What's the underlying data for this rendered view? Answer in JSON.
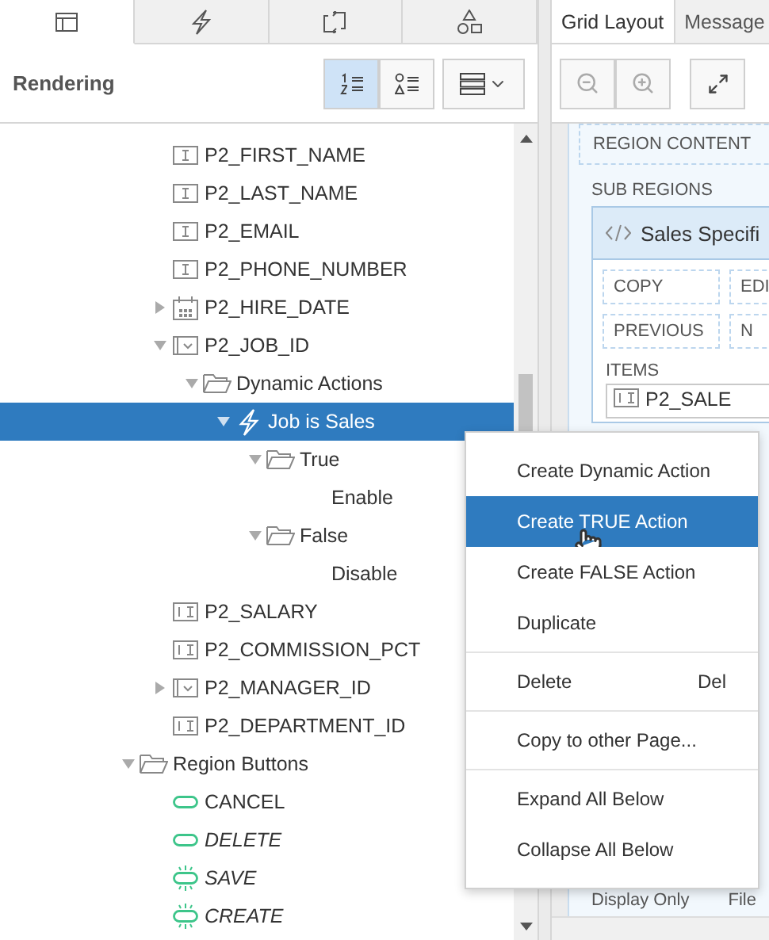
{
  "left_tabs": [
    {
      "kind": "layout",
      "selected": true
    },
    {
      "kind": "lightning",
      "selected": false
    },
    {
      "kind": "loop",
      "selected": false
    },
    {
      "kind": "shapes",
      "selected": false
    }
  ],
  "toolbar": {
    "title": "Rendering",
    "view_buttons": [
      {
        "kind": "numbered",
        "selected": true
      },
      {
        "kind": "shapes",
        "selected": false
      }
    ]
  },
  "tree": {
    "items": [
      {
        "label": "P2_FIRST_NAME",
        "kind": "text"
      },
      {
        "label": "P2_LAST_NAME",
        "kind": "text"
      },
      {
        "label": "P2_EMAIL",
        "kind": "text"
      },
      {
        "label": "P2_PHONE_NUMBER",
        "kind": "text"
      },
      {
        "label": "P2_HIRE_DATE",
        "kind": "date",
        "expanded": false
      },
      {
        "label": "P2_JOB_ID",
        "kind": "select",
        "expanded": true,
        "children": [
          {
            "label": "Dynamic Actions",
            "kind": "folder",
            "expanded": true,
            "children": [
              {
                "label": "Job is Sales",
                "kind": "action",
                "expanded": true,
                "selected": true,
                "children": [
                  {
                    "label": "True",
                    "kind": "folder",
                    "expanded": true,
                    "children": [
                      {
                        "label": "Enable"
                      }
                    ]
                  },
                  {
                    "label": "False",
                    "kind": "folder",
                    "expanded": true,
                    "children": [
                      {
                        "label": "Disable"
                      }
                    ]
                  }
                ]
              }
            ]
          }
        ]
      },
      {
        "label": "P2_SALARY",
        "kind": "number"
      },
      {
        "label": "P2_COMMISSION_PCT",
        "kind": "number"
      },
      {
        "label": "P2_MANAGER_ID",
        "kind": "select",
        "expanded": false
      },
      {
        "label": "P2_DEPARTMENT_ID",
        "kind": "number"
      }
    ],
    "region_buttons": {
      "label": "Region Buttons",
      "kind": "folder",
      "expanded": true,
      "children": [
        {
          "label": "CANCEL",
          "kind": "button",
          "conditional": false
        },
        {
          "label": "DELETE",
          "kind": "button",
          "conditional": true
        },
        {
          "label": "SAVE",
          "kind": "hot",
          "conditional": true
        },
        {
          "label": "CREATE",
          "kind": "hot",
          "conditional": true
        }
      ]
    }
  },
  "right_tabs": [
    {
      "label": "Grid Layout",
      "selected": true
    },
    {
      "label": "Message",
      "selected": false
    }
  ],
  "layout": {
    "region_content": "REGION CONTENT",
    "sub_regions": "SUB REGIONS",
    "card_title": "Sales Specifi",
    "card_buttons": [
      "COPY",
      "EDI",
      "PREVIOUS",
      "N"
    ],
    "items_label": "ITEMS",
    "item": "P2_SALE",
    "footer": [
      "Display Only",
      "File"
    ]
  },
  "context_menu": {
    "groups": [
      [
        {
          "label": "Create Dynamic Action",
          "selected": false
        },
        {
          "label": "Create TRUE Action",
          "selected": true
        },
        {
          "label": "Create FALSE Action",
          "selected": false
        },
        {
          "label": "Duplicate",
          "selected": false
        }
      ],
      [
        {
          "label": "Delete",
          "shortcut": "Del",
          "selected": false
        }
      ],
      [
        {
          "label": "Copy to other Page...",
          "selected": false
        }
      ],
      [
        {
          "label": "Expand All Below",
          "selected": false
        },
        {
          "label": "Collapse All Below",
          "selected": false
        }
      ]
    ]
  }
}
